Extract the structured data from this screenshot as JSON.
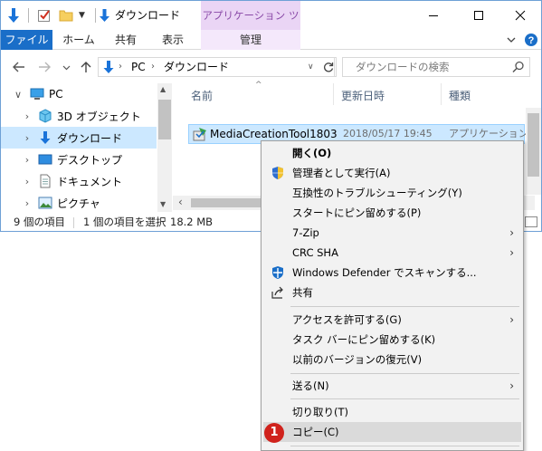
{
  "titlebar": {
    "title": "ダウンロード",
    "context_tab_header": "アプリケーション ツール",
    "minimize_glyph": "—",
    "maximize_glyph": "☐",
    "close_glyph": "✕"
  },
  "ribbon": {
    "tabs": [
      "ファイル",
      "ホーム",
      "共有",
      "表示",
      "管理"
    ]
  },
  "address": {
    "path": [
      "PC",
      "ダウンロード"
    ],
    "search_placeholder": "ダウンロードの検索"
  },
  "navpane": {
    "items": [
      {
        "label": "PC",
        "icon": "pc-icon"
      },
      {
        "label": "3D オブジェクト",
        "icon": "3d-objects-icon"
      },
      {
        "label": "ダウンロード",
        "icon": "download-icon"
      },
      {
        "label": "デスクトップ",
        "icon": "desktop-icon"
      },
      {
        "label": "ドキュメント",
        "icon": "documents-icon"
      },
      {
        "label": "ピクチャ",
        "icon": "pictures-icon"
      }
    ]
  },
  "columns": {
    "name": "名前",
    "date": "更新日時",
    "type": "種類"
  },
  "files": [
    {
      "name": "MediaCreationTool1803",
      "date": "2018/05/17 19:45",
      "type": "アプリケーション"
    }
  ],
  "status": {
    "item_count": "9 個の項目",
    "selection": "1 個の項目を選択",
    "size": "18.2 MB"
  },
  "context_menu": {
    "items": [
      {
        "label": "開く(O)",
        "bold": true
      },
      {
        "label": "管理者として実行(A)",
        "icon": "uac-shield-icon"
      },
      {
        "label": "互換性のトラブルシューティング(Y)"
      },
      {
        "label": "スタートにピン留めする(P)"
      },
      {
        "label": "7-Zip",
        "submenu": true
      },
      {
        "label": "CRC SHA",
        "submenu": true
      },
      {
        "label": "Windows Defender でスキャンする...",
        "icon": "windows-defender-icon"
      },
      {
        "label": "共有",
        "icon": "share-icon"
      },
      {
        "label": "アクセスを許可する(G)",
        "submenu": true
      },
      {
        "label": "タスク バーにピン留めする(K)"
      },
      {
        "label": "以前のバージョンの復元(V)"
      },
      {
        "label": "送る(N)",
        "submenu": true
      },
      {
        "label": "切り取り(T)"
      },
      {
        "label": "コピー(C)",
        "highlighted": true
      }
    ],
    "submenu_glyph": "›"
  },
  "annotation": {
    "step_number": "1",
    "color": "#d0221c"
  },
  "colors": {
    "accent": "#1a6ec8",
    "selection": "#cce8ff",
    "context_tab": "#ead5f5"
  }
}
